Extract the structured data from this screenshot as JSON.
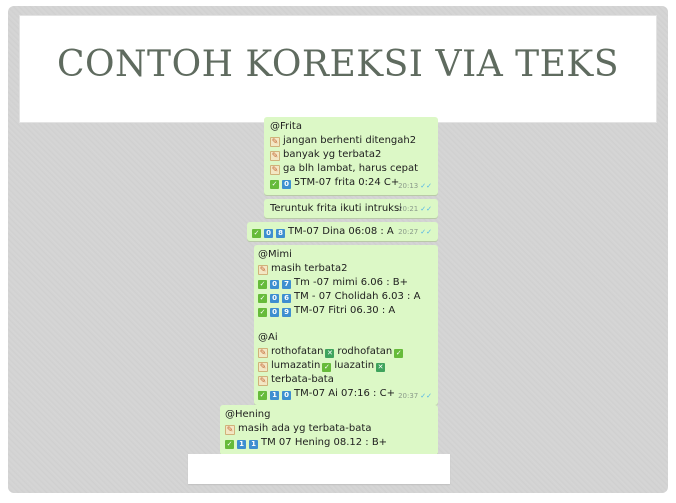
{
  "slide_title": "CONTOH KOREKSI VIA TEKS",
  "accent_bubble_color": "#dcf8c6",
  "messages": [
    {
      "lines": [
        {
          "icon": "",
          "text": "@Frita"
        },
        {
          "icon": "pencil-icon",
          "text": "jangan berhenti ditengah2"
        },
        {
          "icon": "pencil-icon",
          "text": "banyak yg terbata2"
        },
        {
          "icon": "pencil-icon",
          "text": "ga blh lambat, harus cepat"
        },
        {
          "icon": "check-key-icons",
          "text": "5TM-07 frita 0:24 C+"
        }
      ],
      "time": "20:13"
    },
    {
      "lines": [
        {
          "icon": "",
          "text": "Teruntuk frita ikuti intruksi"
        }
      ],
      "time": "20:21"
    },
    {
      "lines": [
        {
          "icon": "check-key-icons",
          "text": "TM-07 Dina 06:08 : A",
          "keys": "0 8"
        }
      ],
      "time": "20:27"
    },
    {
      "lines": [
        {
          "icon": "",
          "text": "@Mimi"
        },
        {
          "icon": "pencil-icon",
          "text": "masih terbata2"
        },
        {
          "icon": "check-key-icons",
          "text": "Tm -07 mimi 6.06 : B+",
          "keys": "0 7"
        },
        {
          "icon": "check-key-icons",
          "text": "TM - 07 Cholidah 6.03 : A",
          "keys": "0 6"
        },
        {
          "icon": "check-key-icons",
          "text": "TM-07 Fitri 06.30 : A",
          "keys": "0 9"
        },
        {
          "icon": "",
          "text": ""
        },
        {
          "icon": "",
          "text": "@Ai"
        },
        {
          "icon": "pencil-icon",
          "text": "rothofatan",
          "extra": "rodhofatan"
        },
        {
          "icon": "pencil-icon",
          "text": "lumazatin",
          "extra": "luazatin"
        },
        {
          "icon": "pencil-icon",
          "text": "terbata-bata"
        },
        {
          "icon": "check-key-icons",
          "text": "TM-07 Ai 07:16 : C+",
          "keys": "1 0"
        }
      ],
      "time": "20:37"
    },
    {
      "lines": [
        {
          "icon": "",
          "text": "@Hening"
        },
        {
          "icon": "pencil-icon",
          "text": "masih ada yg terbata-bata"
        },
        {
          "icon": "check-key-icons",
          "text": "TM 07 Hening 08.12 : B+",
          "keys": "1 1"
        }
      ],
      "time": ""
    }
  ]
}
